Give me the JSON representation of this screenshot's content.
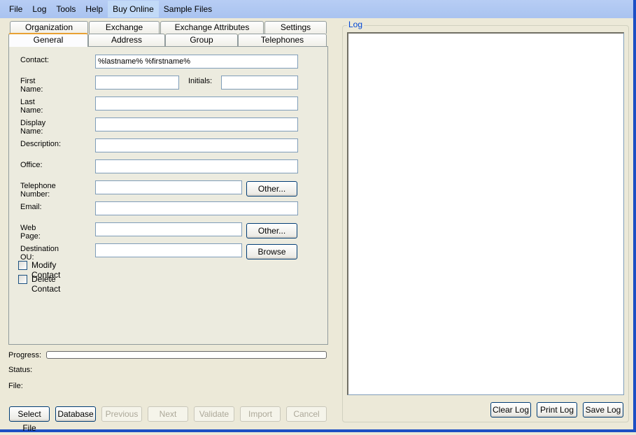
{
  "menu": [
    "File",
    "Log",
    "Tools",
    "Help",
    "Buy Online",
    "Sample Files"
  ],
  "menu_highlighted": "Buy Online",
  "tabs_back_row": [
    "Organization",
    "Exchange",
    "Exchange Attributes",
    "Settings"
  ],
  "tabs_front_row": [
    "General",
    "Address",
    "Group",
    "Telephones"
  ],
  "active_tab": "General",
  "form": {
    "contact": {
      "label": "Contact:",
      "value": "%lastname% %firstname%"
    },
    "first_name": {
      "label": "First Name:",
      "value": ""
    },
    "initials": {
      "label": "Initials:",
      "value": ""
    },
    "last_name": {
      "label": "Last Name:",
      "value": ""
    },
    "display_name": {
      "label": "Display Name:",
      "value": ""
    },
    "description": {
      "label": "Description:",
      "value": ""
    },
    "office": {
      "label": "Office:",
      "value": ""
    },
    "telephone": {
      "label": "Telephone Number:",
      "value": "",
      "button": "Other..."
    },
    "email": {
      "label": "Email:",
      "value": ""
    },
    "web_page": {
      "label": "Web Page:",
      "value": "",
      "button": "Other..."
    },
    "destination_ou": {
      "label": "Destination OU:",
      "value": "",
      "button": "Browse"
    },
    "modify_contact": {
      "label": "Modify Contact",
      "checked": false
    },
    "delete_contact": {
      "label": "Delete Contact",
      "checked": false
    }
  },
  "status_area": {
    "progress_label": "Progress:",
    "progress_value": 0,
    "status_label": "Status:",
    "file_label": "File:"
  },
  "bottom_buttons": [
    {
      "label": "Select File",
      "enabled": true
    },
    {
      "label": "Database",
      "enabled": true
    },
    {
      "label": "Previous",
      "enabled": false
    },
    {
      "label": "Next",
      "enabled": false
    },
    {
      "label": "Validate",
      "enabled": false
    },
    {
      "label": "Import",
      "enabled": false
    },
    {
      "label": "Cancel",
      "enabled": false
    }
  ],
  "log": {
    "title": "Log",
    "content": "",
    "buttons": [
      "Clear Log",
      "Print Log",
      "Save Log"
    ]
  }
}
